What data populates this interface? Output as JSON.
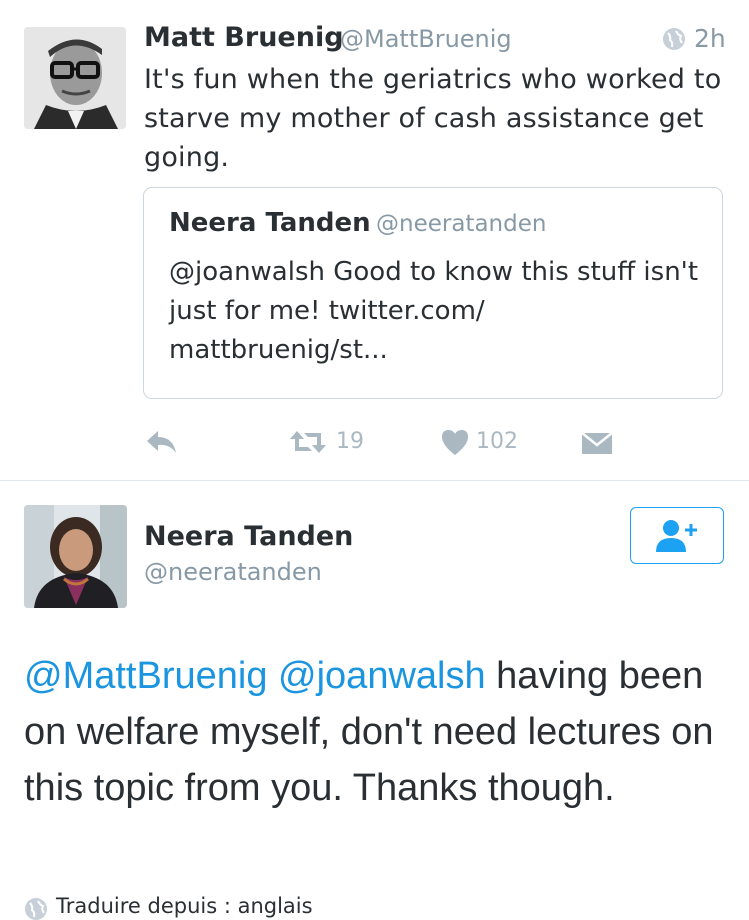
{
  "tweet1": {
    "author_name": "Matt Bruenig",
    "author_handle": "@MattBruenig",
    "time": "2h",
    "text": "It's fun when the geriatrics who worked to starve my mother of cash assistance get going.",
    "quoted": {
      "author_name": "Neera Tanden",
      "author_handle": "@neeratanden",
      "text": "@joanwalsh Good to know this stuff isn't just for me! twitter.com/ mattbruenig/st..."
    },
    "actions": {
      "retweet_count": "19",
      "like_count": "102"
    }
  },
  "tweet2": {
    "author_name": "Neera Tanden",
    "author_handle": "@neeratanden",
    "mention1": "@MattBruenig",
    "mention2": "@joanwalsh",
    "text_rest": "having been on welfare myself, don't need lectures on this topic from you. Thanks though.",
    "translate_label": "Traduire depuis : anglais"
  },
  "icons": {
    "globe": "globe-icon",
    "reply": "reply-icon",
    "retweet": "retweet-icon",
    "like": "heart-icon",
    "dm": "direct-message-icon",
    "follow": "add-user-icon"
  },
  "colors": {
    "link": "#1b95e0",
    "follow_border": "#1da1f2",
    "muted": "#8899a6",
    "action_grey": "#aab8c2"
  }
}
